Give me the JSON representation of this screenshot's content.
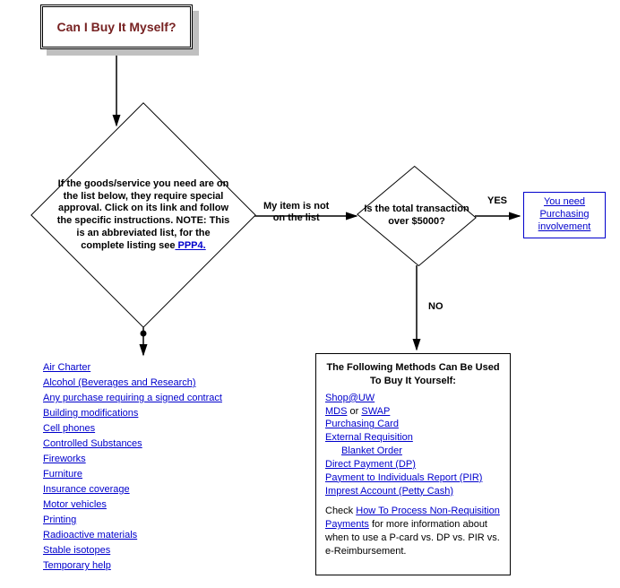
{
  "title": "Can I Buy It\nMyself?",
  "decision1": {
    "pre": "If the goods/service you need are on the list below, they require special approval. Click on its link and follow the specific instructions. NOTE:  This is an abbreviated list, for the complete listing see",
    "link_label": " PPP4.",
    "not_on_list_label": "My item is not\non the list"
  },
  "decision2": {
    "text": "Is the total\ntransaction over\n$5000?",
    "yes_label": "YES",
    "no_label": "NO"
  },
  "purchasing_box": "You need\nPurchasing\ninvolvement",
  "special_items": [
    "Air Charter",
    "Alcohol  (Beverages and Research)",
    "Any purchase requiring a signed contract",
    "Building modifications",
    "Cell phones",
    "Controlled Substances",
    "Fireworks",
    "Furniture",
    "Insurance coverage",
    "Motor vehicles",
    "Printing",
    "Radioactive materials",
    "Stable isotopes",
    "Temporary help"
  ],
  "methods": {
    "title": "The Following Methods Can Be Used To Buy It Yourself:",
    "items": {
      "shop": "Shop@UW",
      "mds": "MDS",
      "or": " or  ",
      "swap": "SWAP",
      "pcard": "Purchasing Card",
      "extreq": "External Requisition",
      "blanket": "Blanket Order",
      "dp": "Direct Payment (DP)",
      "pir": "Payment to Individuals Report (PIR)",
      "imprest": "Imprest Account (Petty Cash)"
    },
    "footer_pre": "Check ",
    "footer_link": "How To Process Non-Requisition Payments",
    "footer_post": "  for more information about when to use a P-card vs. DP vs. PIR vs. e-Reimbursement."
  }
}
